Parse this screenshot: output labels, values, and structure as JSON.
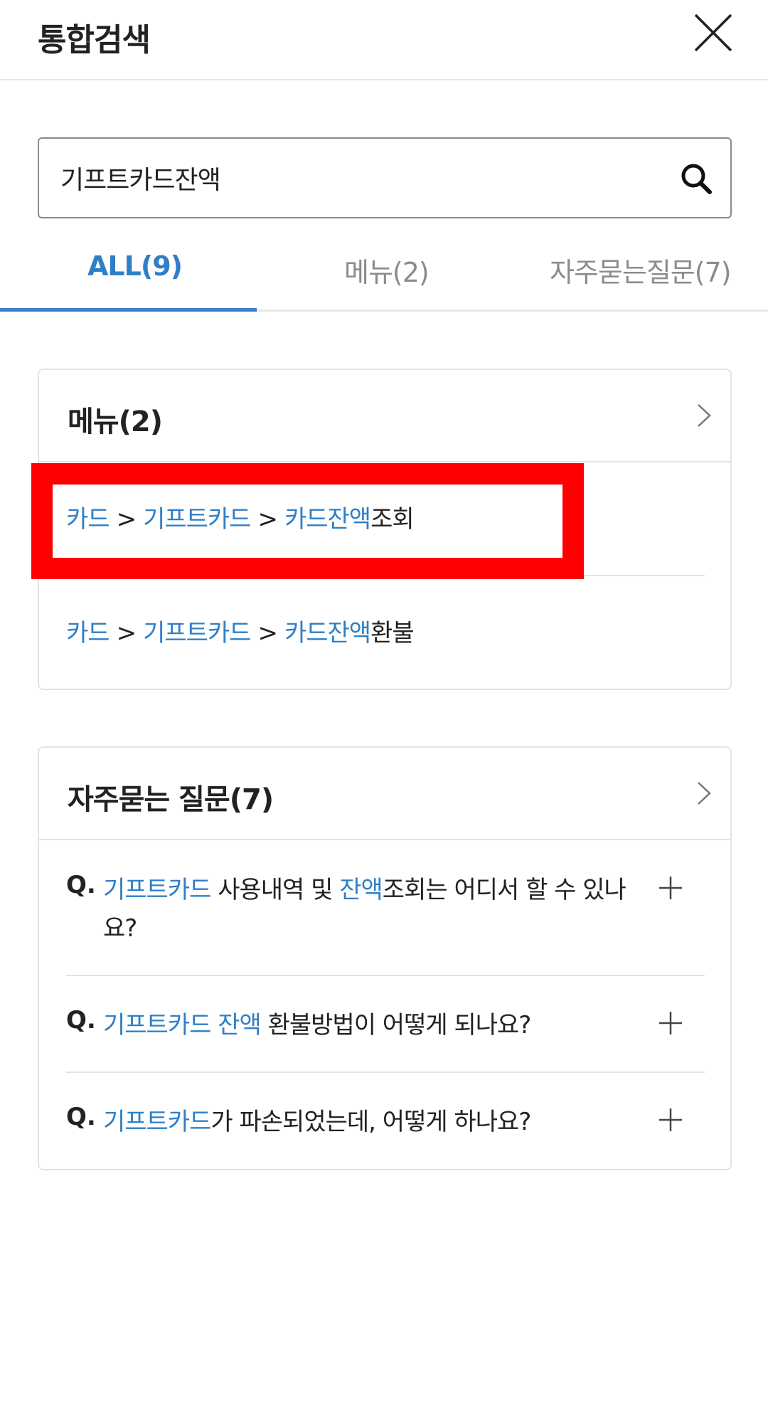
{
  "header": {
    "title": "통합검색"
  },
  "search": {
    "value": "기프트카드잔액"
  },
  "tabs": [
    {
      "label": "ALL(9)",
      "active": true
    },
    {
      "label": "메뉴(2)",
      "active": false
    },
    {
      "label": "자주묻는질문(7)",
      "active": false
    }
  ],
  "menu_section": {
    "title": "메뉴(2)",
    "items": [
      {
        "seg1": "카드",
        "sep1": ">",
        "seg2": "기프트카드",
        "sep2": ">",
        "seg3": "카드잔액",
        "suffix": "조회"
      },
      {
        "seg1": "카드",
        "sep1": ">",
        "seg2": "기프트카드",
        "sep2": ">",
        "seg3": "카드잔액",
        "suffix": "환불"
      }
    ]
  },
  "faq_section": {
    "title": "자주묻는 질문(7)",
    "items": [
      {
        "q": "Q.",
        "hl1": "기프트카드",
        "t1": " 사용내역 및 ",
        "hl2": "잔액",
        "t2": "조회는 어디서 할 수 있나요?"
      },
      {
        "q": "Q.",
        "hl1": "기프트카드",
        "t1": " ",
        "hl2": "잔액",
        "t2": " 환불방법이 어떻게 되나요?"
      },
      {
        "q": "Q.",
        "hl1": "기프트카드",
        "t1": "가 파손되었는데, 어떻게 하나요?",
        "hl2": "",
        "t2": ""
      }
    ]
  },
  "colors": {
    "accent": "#2f7fc7",
    "highlight_box": "#ff0000"
  },
  "icons": {
    "close": "close-icon",
    "search": "search-icon",
    "chevron": "chevron-right-icon",
    "plus": "plus-icon"
  }
}
